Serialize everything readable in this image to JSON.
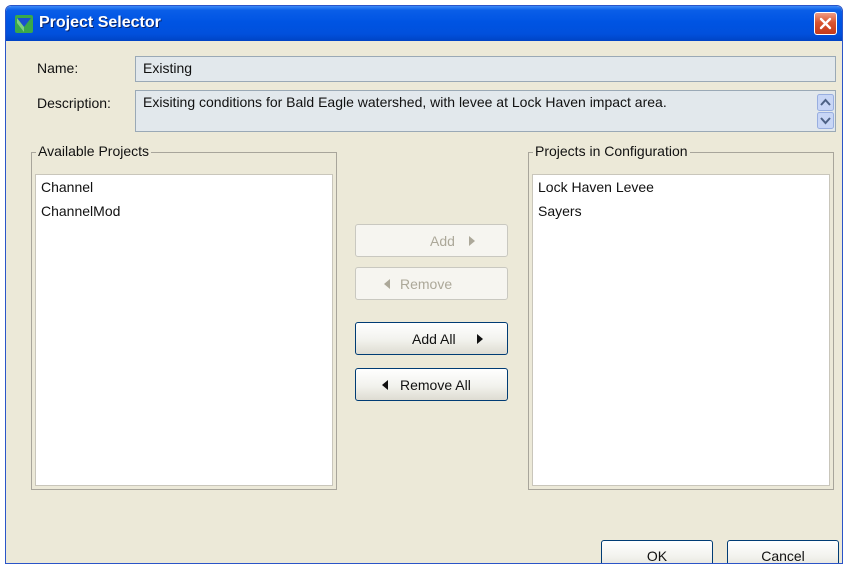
{
  "window": {
    "title": "Project Selector"
  },
  "name_field": {
    "label": "Name:",
    "value": "Existing"
  },
  "description_field": {
    "label": "Description:",
    "value": "Exisiting conditions for Bald Eagle watershed, with levee at Lock Haven impact area."
  },
  "available": {
    "title": "Available Projects",
    "items": [
      "Channel",
      "ChannelMod"
    ]
  },
  "configured": {
    "title": "Projects in Configuration",
    "items": [
      "Lock Haven Levee",
      "Sayers"
    ]
  },
  "buttons": {
    "add": "Add",
    "remove": "Remove",
    "add_all": "Add All",
    "remove_all": "Remove All",
    "ok": "OK",
    "cancel": "Cancel"
  },
  "colors": {
    "titlebar": "#0054e3",
    "dialog_bg": "#ece9d8",
    "field_bg": "#e2e8ec",
    "close_button": "#d9542f"
  }
}
